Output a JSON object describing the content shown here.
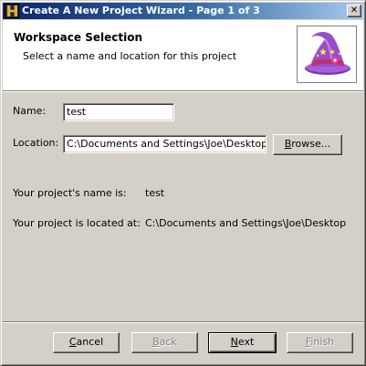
{
  "window": {
    "title": "Create A New Project Wizard - Page 1 of 3",
    "close_glyph": "✕"
  },
  "header": {
    "title": "Workspace Selection",
    "subtitle": "Select a name and location for this project",
    "image_icon": "wizard-hat-icon"
  },
  "form": {
    "name_label": "Name:",
    "name_value": "test",
    "location_label": "Location:",
    "location_value": "C:\\Documents and Settings\\Joe\\Desktop",
    "browse_button": {
      "mnemonic": "B",
      "rest": "rowse..."
    }
  },
  "summary": {
    "name_label": "Your project's name is:",
    "name_value": "test",
    "location_label": "Your project is located at:",
    "location_value": "C:\\Documents and Settings\\Joe\\Desktop"
  },
  "buttons": {
    "cancel": {
      "mnemonic": "C",
      "rest": "ancel",
      "enabled": true
    },
    "back": {
      "mnemonic": "B",
      "rest": "ack",
      "enabled": false
    },
    "next": {
      "mnemonic": "N",
      "rest": "ext",
      "enabled": true
    },
    "finish": {
      "mnemonic": "F",
      "rest": "inish",
      "enabled": false
    }
  },
  "colors": {
    "title_gradient_start": "#0a246a",
    "title_gradient_end": "#a6caf0",
    "face": "#d4d0c8",
    "hat_purple": "#9b4dc8",
    "hat_band": "#c03070"
  }
}
